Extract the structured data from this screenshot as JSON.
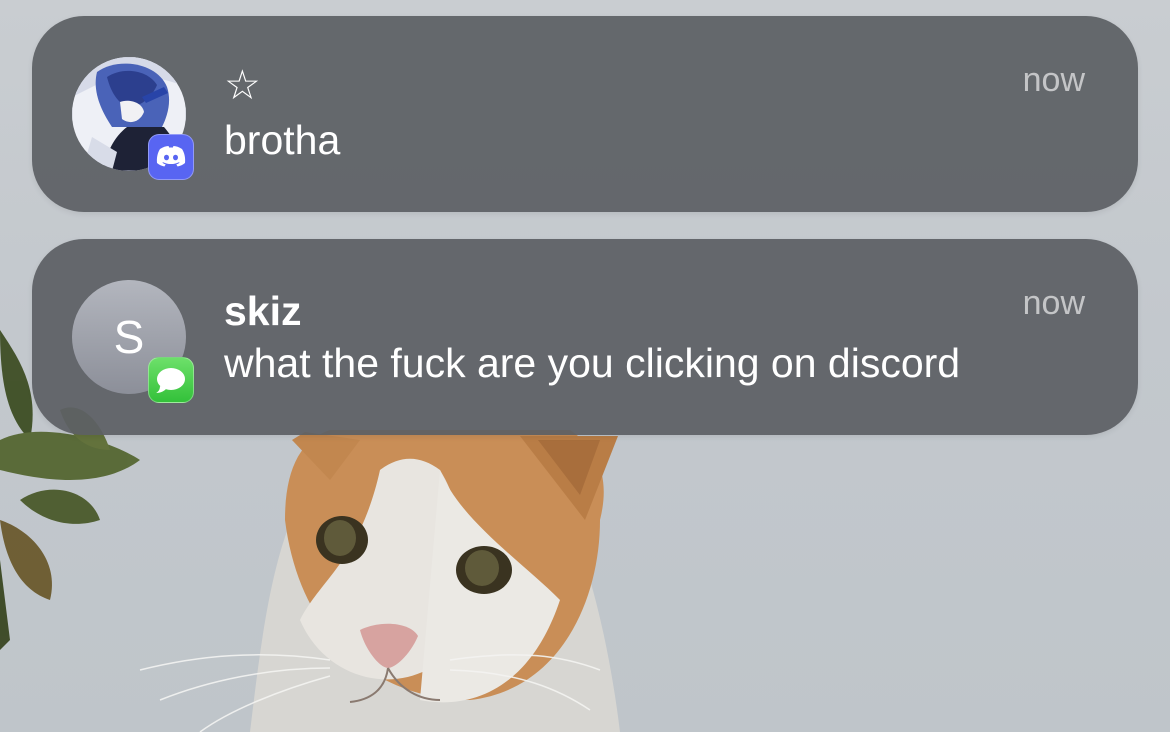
{
  "notifications": [
    {
      "app": "Discord",
      "app_icon": "discord-icon",
      "avatar": "anime-profile-picture",
      "title": "☆",
      "message": "brotha",
      "time": "now"
    },
    {
      "app": "Messages",
      "app_icon": "messages-icon",
      "avatar_initial": "S",
      "title": "skiz",
      "message": "what the fuck are you clicking on discord",
      "time": "now"
    }
  ],
  "colors": {
    "notification_background": "#5c6064",
    "discord_brand": "#5865f2",
    "messages_green": "#34c759",
    "wallpaper_sky": "#c6cbd0"
  }
}
